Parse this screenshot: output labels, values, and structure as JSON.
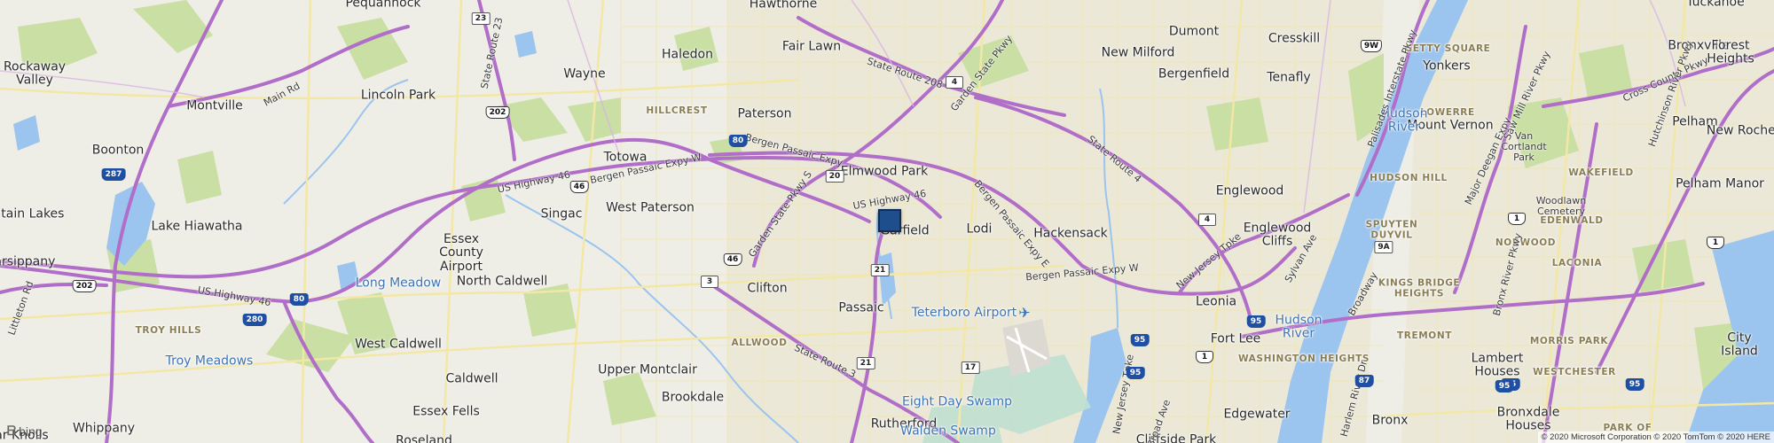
{
  "map": {
    "provider": "bing",
    "attribution": "© 2020 Microsoft Corporation © 2020 TomTom © 2020 HERE",
    "marker": {
      "name": "location-pin",
      "color": "#1f4e8c"
    },
    "colors": {
      "land": "#efeee6",
      "park": "#c9dfa4",
      "water": "#9bc4ee",
      "urban": "#e9e6d6",
      "highway": "#b06ec8",
      "highway_light": "#d8b4e3",
      "street": "#f3e7a6",
      "label_water": "#3d74b5",
      "label_neighborhood": "#8a7d52"
    },
    "places": [
      {
        "key": "pequannock",
        "text": "Pequannock"
      },
      {
        "key": "hawthorne",
        "text": "Hawthorne"
      },
      {
        "key": "dumont",
        "text": "Dumont"
      },
      {
        "key": "tuckahoe",
        "text": "Tuckahoe"
      },
      {
        "key": "rockaway_valley",
        "text": "Rockaway\nValley"
      },
      {
        "key": "haledon",
        "text": "Haledon"
      },
      {
        "key": "fair_lawn",
        "text": "Fair Lawn"
      },
      {
        "key": "new_milford",
        "text": "New Milford"
      },
      {
        "key": "cresskill",
        "text": "Cresskill"
      },
      {
        "key": "bronxville",
        "text": "Bronxville"
      },
      {
        "key": "forest_heights",
        "text": "Forest\nHeights"
      },
      {
        "key": "wayne",
        "text": "Wayne"
      },
      {
        "key": "bergenfield",
        "text": "Bergenfield"
      },
      {
        "key": "tenafly",
        "text": "Tenafly"
      },
      {
        "key": "yonkers",
        "text": "Yonkers"
      },
      {
        "key": "montville",
        "text": "Montville"
      },
      {
        "key": "lincoln_park",
        "text": "Lincoln Park"
      },
      {
        "key": "paterson",
        "text": "Paterson"
      },
      {
        "key": "mount_vernon",
        "text": "Mount Vernon"
      },
      {
        "key": "pelham",
        "text": "Pelham"
      },
      {
        "key": "new_rochelle",
        "text": "New Rochelle"
      },
      {
        "key": "boonton",
        "text": "Boonton"
      },
      {
        "key": "totowa",
        "text": "Totowa"
      },
      {
        "key": "elmwood_park",
        "text": "Elmwood Park"
      },
      {
        "key": "englewood",
        "text": "Englewood"
      },
      {
        "key": "pelham_manor",
        "text": "Pelham Manor"
      },
      {
        "key": "mountain_lakes",
        "text": "untain Lakes"
      },
      {
        "key": "singac",
        "text": "Singac"
      },
      {
        "key": "west_paterson",
        "text": "West Paterson"
      },
      {
        "key": "garfield",
        "text": "Garfield"
      },
      {
        "key": "lodi",
        "text": "Lodi"
      },
      {
        "key": "hackensack",
        "text": "Hackensack"
      },
      {
        "key": "lake_hiawatha",
        "text": "Lake Hiawatha"
      },
      {
        "key": "essex_county_airport",
        "text": "Essex\nCounty\nAirport"
      },
      {
        "key": "englewood_cliffs",
        "text": "Englewood\nCliffs"
      },
      {
        "key": "parsippany",
        "text": "Parsippany"
      },
      {
        "key": "north_caldwell",
        "text": "North Caldwell"
      },
      {
        "key": "clifton",
        "text": "Clifton"
      },
      {
        "key": "leonia",
        "text": "Leonia"
      },
      {
        "key": "passaic",
        "text": "Passaic"
      },
      {
        "key": "fort_lee",
        "text": "Fort Lee"
      },
      {
        "key": "west_caldwell",
        "text": "West Caldwell"
      },
      {
        "key": "lambert_houses",
        "text": "Lambert\nHouses"
      },
      {
        "key": "city_island",
        "text": "City\nIsland"
      },
      {
        "key": "caldwell",
        "text": "Caldwell"
      },
      {
        "key": "upper_montclair",
        "text": "Upper Montclair"
      },
      {
        "key": "essex_fells",
        "text": "Essex Fells"
      },
      {
        "key": "brookdale",
        "text": "Brookdale"
      },
      {
        "key": "edgewater",
        "text": "Edgewater"
      },
      {
        "key": "whippany",
        "text": "Whippany"
      },
      {
        "key": "rutherford",
        "text": "Rutherford"
      },
      {
        "key": "bronx",
        "text": "Bronx"
      },
      {
        "key": "bronxdale_houses",
        "text": "Bronxdale\nHouses"
      },
      {
        "key": "roseland",
        "text": "Roseland"
      },
      {
        "key": "cliffside_park",
        "text": "Cliffside Park"
      },
      {
        "key": "morris_knolls",
        "text": "dar Knolls"
      }
    ],
    "neighborhoods": [
      {
        "key": "getty_square",
        "text": "GETTY SQUARE"
      },
      {
        "key": "hillcrest",
        "text": "HILLCREST"
      },
      {
        "key": "lowerre",
        "text": "LOWERRE"
      },
      {
        "key": "hudson_hill",
        "text": "HUDSON HILL"
      },
      {
        "key": "wakefield",
        "text": "WAKEFIELD"
      },
      {
        "key": "spuyten_duyvil",
        "text": "SPUYTEN\nDUYVIL"
      },
      {
        "key": "norwood",
        "text": "NORWOOD"
      },
      {
        "key": "edenwald",
        "text": "EDENWALD"
      },
      {
        "key": "laconia",
        "text": "LACONIA"
      },
      {
        "key": "kings_bridge_heights",
        "text": "KINGS BRIDGE\nHEIGHTS"
      },
      {
        "key": "troy_hills",
        "text": "TROY HILLS"
      },
      {
        "key": "allwood",
        "text": "ALLWOOD"
      },
      {
        "key": "tremont",
        "text": "TREMONT"
      },
      {
        "key": "morris_park",
        "text": "MORRIS PARK"
      },
      {
        "key": "washington_heights",
        "text": "WASHINGTON HEIGHTS"
      },
      {
        "key": "westchester",
        "text": "WESTCHESTER"
      },
      {
        "key": "park_of",
        "text": "PARK OF"
      }
    ],
    "water_labels": [
      {
        "key": "hudson_river_n",
        "text": "Hudson\nRiver"
      },
      {
        "key": "long_meadow",
        "text": "Long Meadow"
      },
      {
        "key": "troy_meadows",
        "text": "Troy Meadows"
      },
      {
        "key": "hudson_river_s",
        "text": "Hudson\nRiver"
      },
      {
        "key": "eight_day_swamp",
        "text": "Eight Day Swamp"
      },
      {
        "key": "walden_swamp",
        "text": "Walden Swamp"
      }
    ],
    "airport_label": {
      "text": "Teterboro Airport"
    },
    "road_labels": [
      {
        "key": "state_route_23",
        "text": "State Route 23"
      },
      {
        "key": "state_route_208",
        "text": "State Route 208"
      },
      {
        "key": "garden_state_pkwy",
        "text": "Garden State Pkwy"
      },
      {
        "key": "main_rd",
        "text": "Main Rd"
      },
      {
        "key": "state_route_4",
        "text": "State Route 4"
      },
      {
        "key": "palisades_pkwy",
        "text": "Palisades Interstate Pkwy"
      },
      {
        "key": "bergen_passaic_expy_w1",
        "text": "Bergen Passaic Expy W"
      },
      {
        "key": "bergen_passaic_expy_w2",
        "text": "Bergen Passaic Expy W"
      },
      {
        "key": "bergen_passaic_expy",
        "text": "Bergen Passaic Expy"
      },
      {
        "key": "us_highway_46_a",
        "text": "US Highway 46"
      },
      {
        "key": "us_highway_46_b",
        "text": "US Highway 46"
      },
      {
        "key": "us_highway_46_c",
        "text": "US Highway 46"
      },
      {
        "key": "garden_state_pkwy_s",
        "text": "Garden State Pkwy S"
      },
      {
        "key": "bergen_passaic_expy_e",
        "text": "Bergen Passaic Expy E"
      },
      {
        "key": "bergen_passaic_expy_w3",
        "text": "Bergen Passaic Expy W"
      },
      {
        "key": "new_jersey_tpke",
        "text": "New Jersey Tpke"
      },
      {
        "key": "new_jersey_tpke_2",
        "text": "New Jersey Tpke"
      },
      {
        "key": "sylvan_ave",
        "text": "Sylvan Ave"
      },
      {
        "key": "littleton_rd",
        "text": "Littleton Rd"
      },
      {
        "key": "state_route_3",
        "text": "State Route 3"
      },
      {
        "key": "broadway",
        "text": "Broadway"
      },
      {
        "key": "major_deegan_expy",
        "text": "Major Deegan Expy"
      },
      {
        "key": "mill_river_pkwy",
        "text": "Saw Mill River Pkwy"
      },
      {
        "key": "cross_county_pkwy",
        "text": "Cross County Pkwy"
      },
      {
        "key": "hutchinson_pkwy",
        "text": "Hutchinson River Pkwy"
      },
      {
        "key": "bronx_river_pkwy",
        "text": "Bronx River Pkwy"
      },
      {
        "key": "van_cortlandt_park",
        "text": "Van\nCortlandt\nPark"
      },
      {
        "key": "woodlawn_cemetery",
        "text": "Woodlawn\nCemetery"
      },
      {
        "key": "broad_ave",
        "text": "Broad Ave"
      },
      {
        "key": "harlem_river_dr",
        "text": "Harlem River Dr"
      }
    ],
    "shields": [
      {
        "key": "s23",
        "text": "23",
        "type": "state"
      },
      {
        "key": "s202a",
        "text": "202",
        "type": "us"
      },
      {
        "key": "s4a",
        "text": "4",
        "type": "state"
      },
      {
        "key": "s287",
        "text": "287",
        "type": "i"
      },
      {
        "key": "s80a",
        "text": "80",
        "type": "i"
      },
      {
        "key": "s46a",
        "text": "46",
        "type": "us"
      },
      {
        "key": "s20",
        "text": "20",
        "type": "state"
      },
      {
        "key": "s4b",
        "text": "4",
        "type": "state"
      },
      {
        "key": "s9w",
        "text": "9W",
        "type": "us"
      },
      {
        "key": "s202b",
        "text": "202",
        "type": "us"
      },
      {
        "key": "s80b",
        "text": "80",
        "type": "i"
      },
      {
        "key": "s46b",
        "text": "46",
        "type": "us"
      },
      {
        "key": "s3",
        "text": "3",
        "type": "state"
      },
      {
        "key": "s21a",
        "text": "21",
        "type": "state"
      },
      {
        "key": "s280",
        "text": "280",
        "type": "i"
      },
      {
        "key": "s95a",
        "text": "95",
        "type": "i"
      },
      {
        "key": "s9a",
        "text": "9A",
        "type": "state"
      },
      {
        "key": "s1a",
        "text": "1",
        "type": "us"
      },
      {
        "key": "s1b",
        "text": "1",
        "type": "us"
      },
      {
        "key": "s95b",
        "text": "95",
        "type": "i"
      },
      {
        "key": "s21b",
        "text": "21",
        "type": "state"
      },
      {
        "key": "s17",
        "text": "17",
        "type": "state"
      },
      {
        "key": "s95c",
        "text": "95",
        "type": "i"
      },
      {
        "key": "s95d",
        "text": "95",
        "type": "i"
      },
      {
        "key": "s87",
        "text": "87",
        "type": "i"
      },
      {
        "key": "s95e",
        "text": "95",
        "type": "i"
      },
      {
        "key": "s95f",
        "text": "95",
        "type": "i"
      },
      {
        "key": "s1c",
        "text": "1",
        "type": "us"
      }
    ],
    "bing_logo": "bing",
    "edge_text": "dar Knolls"
  }
}
